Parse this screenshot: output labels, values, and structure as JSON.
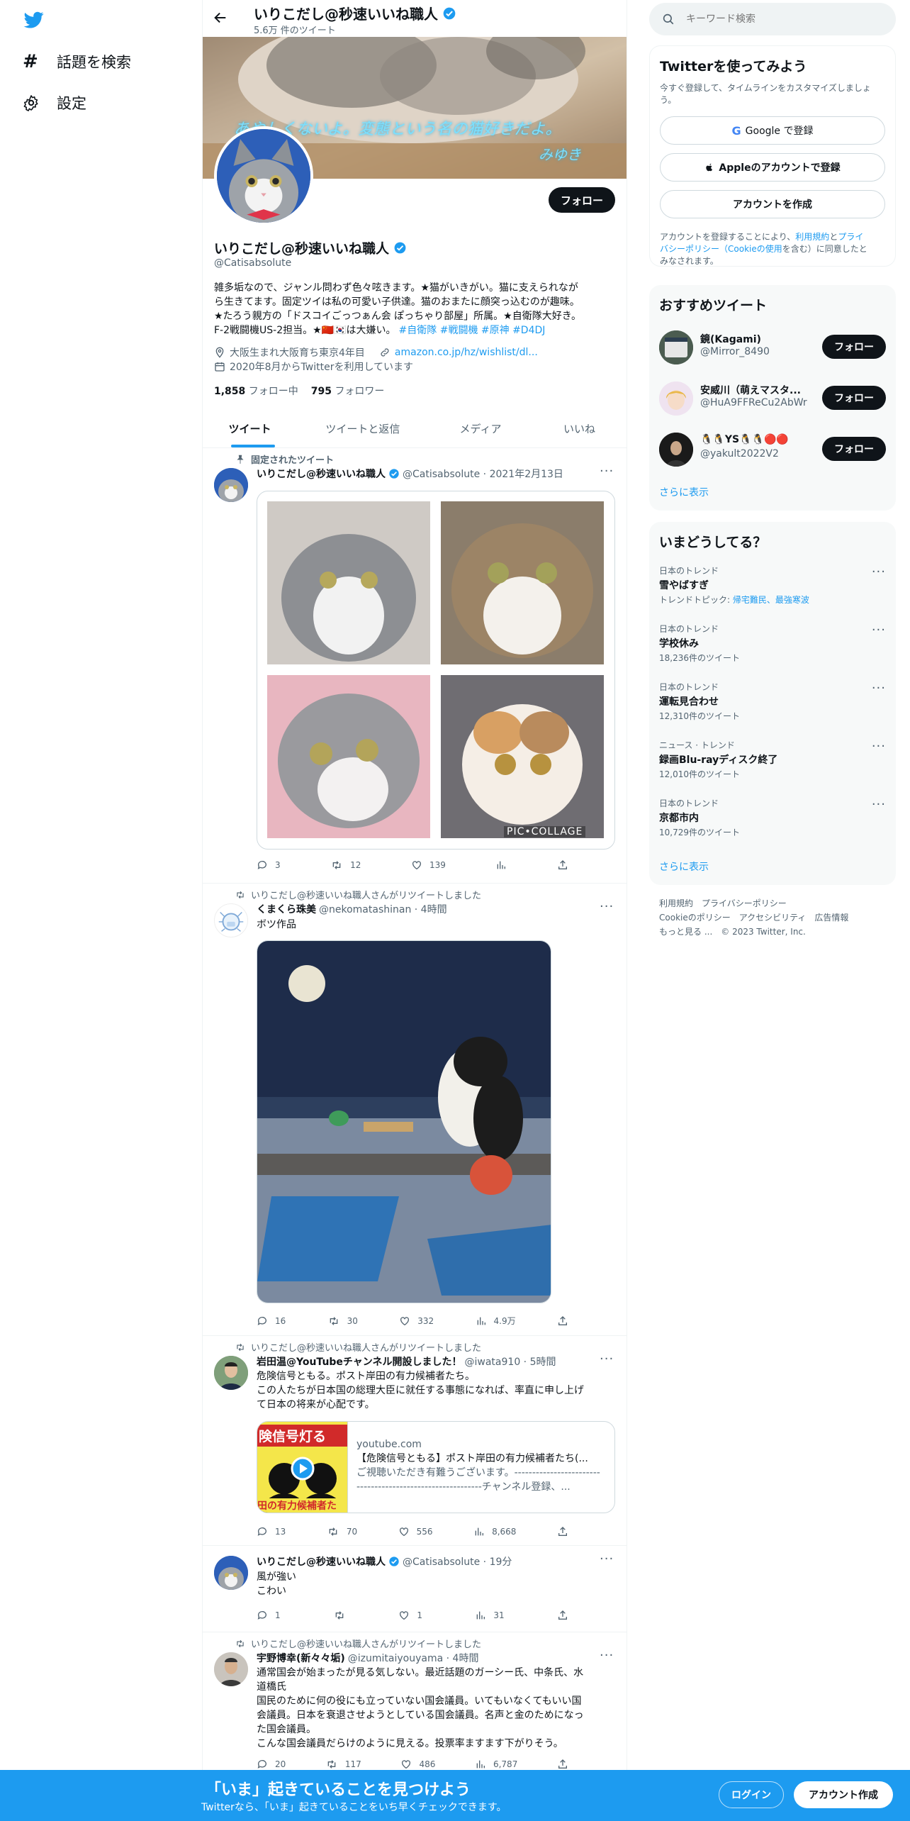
{
  "nav": {
    "explore": "話題を検索",
    "settings": "設定"
  },
  "header": {
    "name": "いりこだし@秒速いいね職人",
    "tweet_count": "5.6万 件のツイート"
  },
  "banner": {
    "handwriting_line1": "あやしくないよ。変態という名の猫好きだよ。",
    "handwriting_line2": "みゆき"
  },
  "profile": {
    "follow_button": "フォロー",
    "name": "いりこだし@秒速いいね職人",
    "handle": "@Catisabsolute",
    "bio_line1": "雑多垢なので、ジャンル問わず色々呟きます。★猫がいきがい。猫に支えられなが",
    "bio_line2": "ら生きてます。固定ツイは私の可愛い子供達。猫のおまたに顔突っ込むのが趣味。",
    "bio_line3": "★たろう親方の「ドスコイごっつぁん会 ぽっちゃり部屋」所属。★自衛隊大好き。",
    "bio_line4_text": "F-2戦闘機US-2担当。★🇨🇳🇰🇷は大嫌い。",
    "bio_tags": "#自衛隊 #戦闘機 #原神 #D4DJ",
    "location": "大阪生まれ大阪育ち東京4年目",
    "link": "amazon.co.jp/hz/wishlist/dl...",
    "joined": "2020年8月からTwitterを利用しています",
    "following_count": "1,858",
    "following_label": "フォロー中",
    "followers_count": "795",
    "followers_label": "フォロワー"
  },
  "tabs": [
    "ツイート",
    "ツイートと返信",
    "メディア",
    "いいね"
  ],
  "tweets": {
    "pinned": {
      "pinned_label": "固定されたツイート",
      "name": "いりこだし@秒速いいね職人",
      "meta": "@Catisabsolute · 2021年2月13日",
      "watermark": "PIC•COLLAGE",
      "replies": "3",
      "retweets": "12",
      "likes": "139"
    },
    "t2": {
      "retweet_label": "いりこだし@秒速いいね職人さんがリツイートしました",
      "name": "くまくら珠美",
      "meta": "@nekomatashinan · 4時間",
      "text": "ボツ作品",
      "replies": "16",
      "retweets": "30",
      "likes": "332",
      "views": "4.9万"
    },
    "t3": {
      "retweet_label": "いりこだし@秒速いいね職人さんがリツイートしました",
      "name": "岩田温@YouTubeチャンネル開設しました！",
      "meta": "@iwata910 · 5時間",
      "text_line1": "危険信号ともる。ポスト岸田の有力候補者たち。",
      "text_line2": "この人たちが日本国の総理大臣に就任する事態になれば、率直に申し上げ",
      "text_line3": "て日本の将来が心配です。",
      "card_thumb_text1": "険信号灯る",
      "card_thumb_text2": "田の有力候補者た",
      "card_domain": "youtube.com",
      "card_title": "【危険信号ともる】ポスト岸田の有力候補者たち(...",
      "card_desc1": "ご視聴いただき有難うございます。------------------------",
      "card_desc2": "-----------------------------------チャンネル登録、...",
      "replies": "13",
      "retweets": "70",
      "likes": "556",
      "views": "8,668"
    },
    "t4": {
      "name": "いりこだし@秒速いいね職人",
      "meta": "@Catisabsolute · 19分",
      "text_line1": "風が強い",
      "text_line2": "こわい",
      "replies": "1",
      "likes": "1",
      "views": "31"
    },
    "t5": {
      "retweet_label": "いりこだし@秒速いいね職人さんがリツイートしました",
      "name": "宇野博幸(新々々垢)",
      "meta": "@izumitaiyouyama · 4時間",
      "text_line1": "通常国会が始まったが見る気しない。最近話題のガーシー氏、中条氏、水",
      "text_line2": "道橋氏",
      "text_line3": "国民のために何の役にも立っていない国会議員。いてもいなくてもいい国",
      "text_line4": "会議員。日本を衰退させようとしている国会議員。名声と金のためになっ",
      "text_line5": "た国会議員。",
      "text_line6": "こんな国会議員だらけのように見える。投票率ますます下がりそう。",
      "replies": "20",
      "retweets": "117",
      "likes": "486",
      "views": "6,787"
    }
  },
  "search": {
    "placeholder": "キーワード検索"
  },
  "signup": {
    "title": "Twitterを使ってみよう",
    "subtitle_line1": "今すぐ登録して、タイムラインをカスタマイズしましょ",
    "subtitle_line2": "う。",
    "google": "Google で登録",
    "apple": "Appleのアカウントで登録",
    "create": "アカウントを作成",
    "terms_line1_a": "アカウントを登録することにより、",
    "terms_link1": "利用規約",
    "terms_line1_b": "と",
    "terms_link2": "プライ",
    "terms_line2_a": "バシーポリシー",
    "terms_link3": "（Cookieの使用",
    "terms_line2_b": "を含む）に同意したと",
    "terms_line3": "みなされます。"
  },
  "recommended": {
    "title": "おすすめツイート",
    "users": [
      {
        "name": "鏡(Kagami)",
        "handle": "@Mirror_8490",
        "button": "フォロー"
      },
      {
        "name": "安威川（萌えマスタ...",
        "handle": "@HuA9FFReCu2AbWr",
        "button": "フォロー"
      },
      {
        "name": "🐧🐧YS🐧🐧🔴🔴",
        "handle": "@yakult2022V2",
        "button": "フォロー"
      }
    ],
    "more": "さらに表示"
  },
  "trends": {
    "title": "いまどうしてる？",
    "items": [
      {
        "category": "日本のトレンド",
        "name": "雪やばすぎ",
        "meta_prefix": "トレンドトピック: ",
        "meta_links": "帰宅難民、最強寒波"
      },
      {
        "category": "日本のトレンド",
        "name": "学校休み",
        "meta": "18,236件のツイート"
      },
      {
        "category": "日本のトレンド",
        "name": "運転見合わせ",
        "meta": "12,310件のツイート"
      },
      {
        "category": "ニュース · トレンド",
        "name": "録画Blu-rayディスク終了",
        "meta": "12,010件のツイート"
      },
      {
        "category": "日本のトレンド",
        "name": "京都市内",
        "meta": "10,729件のツイート"
      }
    ],
    "more": "さらに表示"
  },
  "footer": {
    "line1": "利用規約　プライバシーポリシー",
    "line2": "Cookieのポリシー　アクセシビリティ　広告情報",
    "line3": "もっと見る ...　© 2023 Twitter, Inc."
  },
  "bottom_bar": {
    "title": "「いま」起きていることを見つけよう",
    "subtitle": "Twitterなら、「いま」起きていることをいち早くチェックできます。",
    "login": "ログイン",
    "signup": "アカウント作成"
  },
  "colors": {
    "accent": "#1d9bf0",
    "text": "#0f1419",
    "secondary": "#536471"
  }
}
